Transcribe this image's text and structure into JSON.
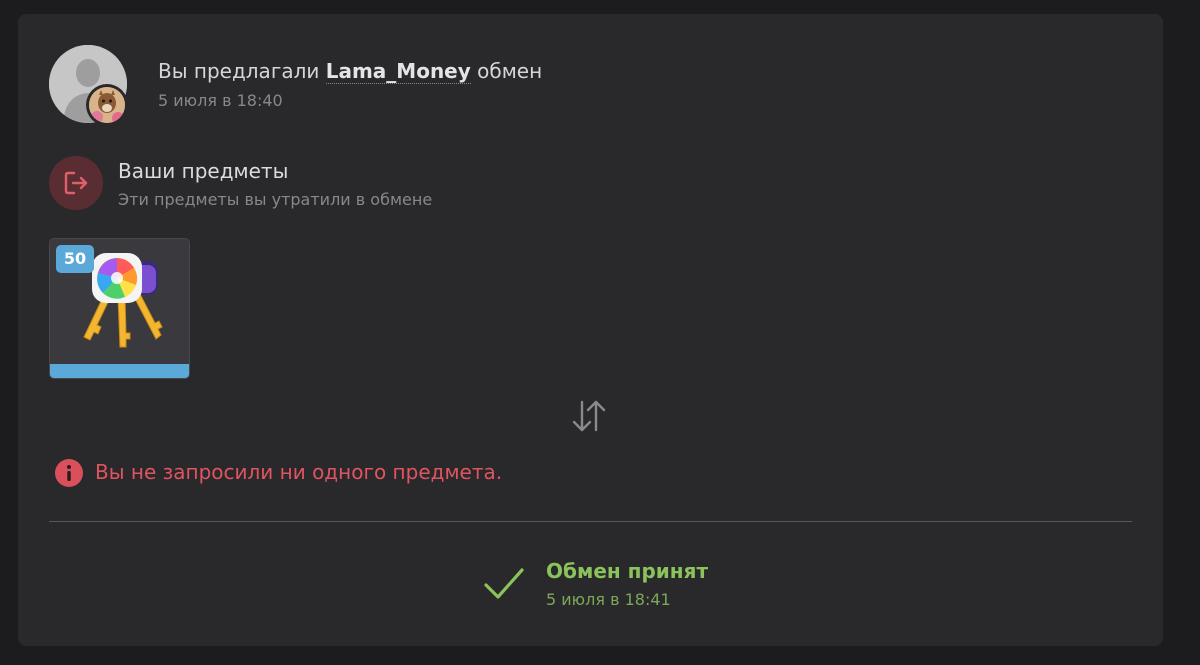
{
  "offer": {
    "prefix": "Вы предлагали",
    "user": "Lama_Money",
    "suffix": "обмен",
    "time": "5 июля в 18:40"
  },
  "your_items": {
    "title": "Ваши предметы",
    "subtitle": "Эти предметы вы утратили в обмене",
    "icon": "exit-icon",
    "items": [
      {
        "quantity": "50",
        "icon": "keys-icon",
        "rarity_color": "#5aa9d9"
      }
    ]
  },
  "swap_icon": "swap-arrows-icon",
  "warning": {
    "icon": "info-icon",
    "text": "Вы не запросили ни одного предмета.",
    "color": "#e0545f"
  },
  "status": {
    "icon": "check-icon",
    "title": "Обмен принят",
    "time": "5 июля в 18:41",
    "color": "#8bc25b"
  }
}
